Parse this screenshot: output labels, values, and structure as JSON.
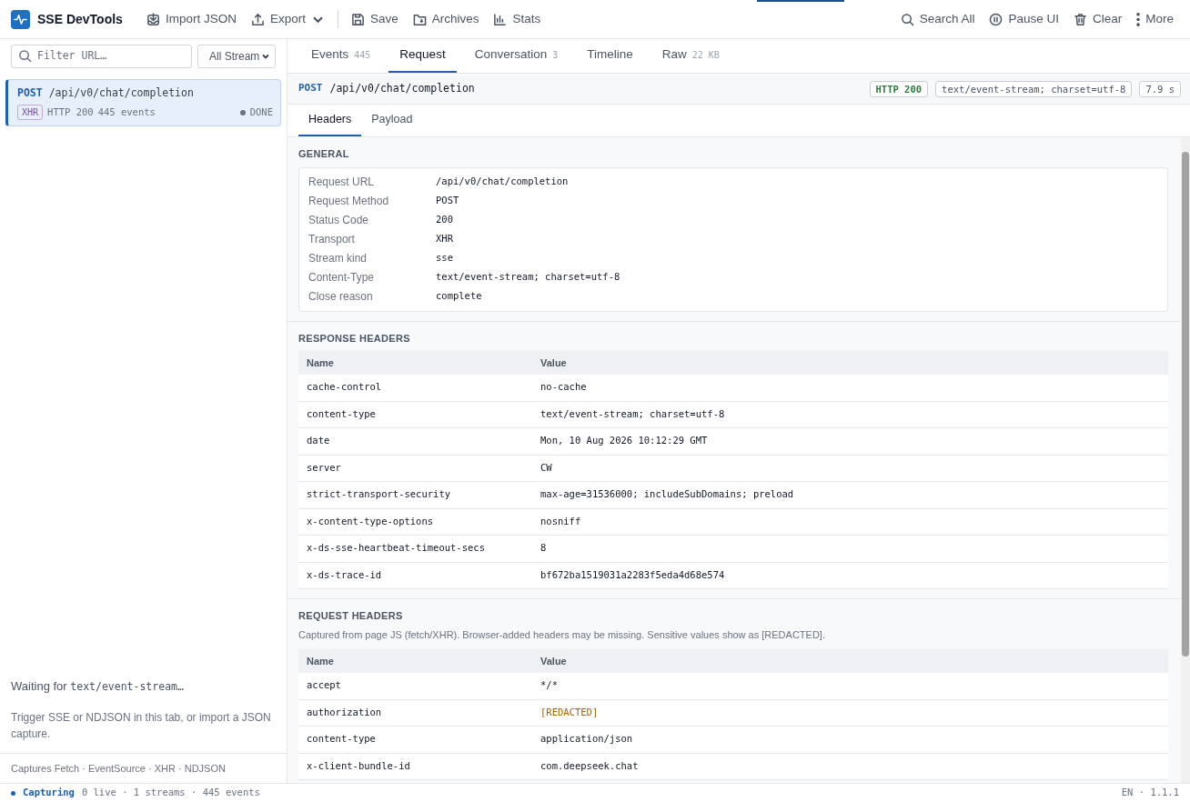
{
  "app": {
    "title": "SSE DevTools"
  },
  "toolbar": [
    {
      "label": "Import JSON",
      "kind": "import",
      "caret": false
    },
    {
      "label": "Export",
      "kind": "export",
      "caret": true
    },
    {
      "label": "Save",
      "kind": "save",
      "caret": false
    },
    {
      "label": "Archives",
      "kind": "archive",
      "caret": false
    },
    {
      "label": "Stats",
      "kind": "stats",
      "caret": false
    }
  ],
  "actions": [
    {
      "label": "Search All",
      "kind": "search"
    },
    {
      "label": "Pause UI",
      "kind": "pause"
    },
    {
      "label": "Clear",
      "kind": "clear"
    },
    {
      "label": "More",
      "kind": "more"
    }
  ],
  "sidebar": {
    "filter": {
      "placeholder": "Filter URL…"
    },
    "stream_select": {
      "value": "All Stream"
    },
    "streams": [
      {
        "method": "POST",
        "url": "/api/v0/chat/completion",
        "transport": "XHR",
        "status": "HTTP 200",
        "events": "445 events",
        "state": "DONE",
        "selected": true
      }
    ],
    "empty_state": {
      "title": "Waiting for",
      "mime": "text/event-stream…",
      "hint": "Trigger SSE or NDJSON in this tab, or import a JSON capture."
    },
    "footer": "Captures Fetch · EventSource · XHR · NDJSON"
  },
  "tabs": [
    {
      "label": "Events",
      "count": "445",
      "selected": false
    },
    {
      "label": "Request",
      "selected": true
    },
    {
      "label": "Conversation",
      "count": "3",
      "selected": false
    },
    {
      "label": "Timeline",
      "selected": false
    },
    {
      "label": "Raw",
      "count": "22 KB",
      "selected": false
    }
  ],
  "request": {
    "method": "POST",
    "url": "/api/v0/chat/completion",
    "badges": [
      {
        "text": "HTTP 200",
        "kind": "status"
      },
      {
        "text": "text/event-stream; charset=utf-8",
        "kind": "plain"
      },
      {
        "text": "7.9 s",
        "kind": "plain"
      }
    ]
  },
  "subtabs": [
    {
      "label": "Headers",
      "selected": true
    },
    {
      "label": "Payload",
      "selected": false
    }
  ],
  "general": {
    "title": "GENERAL",
    "rows": [
      {
        "label": "Request URL",
        "value": "/api/v0/chat/completion"
      },
      {
        "label": "Request Method",
        "value": "POST"
      },
      {
        "label": "Status Code",
        "value": "200"
      },
      {
        "label": "Transport",
        "value": "XHR"
      },
      {
        "label": "Stream kind",
        "value": "sse"
      },
      {
        "label": "Content-Type",
        "value": "text/event-stream; charset=utf-8"
      },
      {
        "label": "Close reason",
        "value": "complete"
      }
    ]
  },
  "response_headers": {
    "title": "RESPONSE HEADERS",
    "columns": [
      "Name",
      "Value"
    ],
    "rows": [
      {
        "name": "cache-control",
        "value": "no-cache",
        "redacted": false
      },
      {
        "name": "content-type",
        "value": "text/event-stream; charset=utf-8",
        "redacted": false
      },
      {
        "name": "date",
        "value": "Mon, 10 Aug 2026 10:12:29 GMT",
        "redacted": false
      },
      {
        "name": "server",
        "value": "CW",
        "redacted": false
      },
      {
        "name": "strict-transport-security",
        "value": "max-age=31536000; includeSubDomains; preload",
        "redacted": false
      },
      {
        "name": "x-content-type-options",
        "value": "nosniff",
        "redacted": false
      },
      {
        "name": "x-ds-sse-heartbeat-timeout-secs",
        "value": "8",
        "redacted": false
      },
      {
        "name": "x-ds-trace-id",
        "value": "bf672ba1519031a2283f5eda4d68e574",
        "redacted": false
      }
    ]
  },
  "request_headers": {
    "title": "REQUEST HEADERS",
    "note": "Captured from page JS (fetch/XHR). Browser-added headers may be missing. Sensitive values show as [REDACTED].",
    "columns": [
      "Name",
      "Value"
    ],
    "rows": [
      {
        "name": "accept",
        "value": "*/*",
        "redacted": false
      },
      {
        "name": "authorization",
        "value": "[REDACTED]",
        "redacted": true
      },
      {
        "name": "content-type",
        "value": "application/json",
        "redacted": false
      },
      {
        "name": "x-client-bundle-id",
        "value": "com.deepseek.chat",
        "redacted": false
      }
    ]
  },
  "status_bar": {
    "state": "Capturing",
    "stats": "0 live · 1 streams · 445 events",
    "version": "EN · 1.1.1"
  }
}
